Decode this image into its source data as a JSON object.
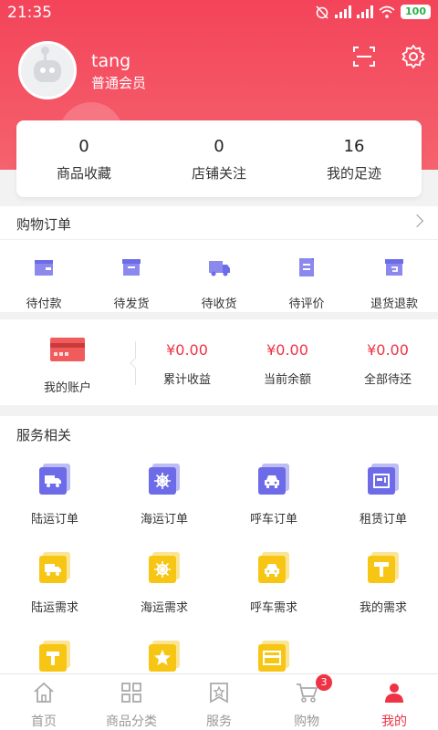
{
  "status_bar": {
    "time": "21:35",
    "battery": "100"
  },
  "profile": {
    "username": "tang",
    "level": "普通会员"
  },
  "stats": [
    {
      "value": "0",
      "label": "商品收藏"
    },
    {
      "value": "0",
      "label": "店铺关注"
    },
    {
      "value": "16",
      "label": "我的足迹"
    }
  ],
  "orders": {
    "title": "购物订单",
    "items": [
      {
        "label": "待付款",
        "icon": "wallet-card-icon"
      },
      {
        "label": "待发货",
        "icon": "box-icon"
      },
      {
        "label": "待收货",
        "icon": "truck-icon"
      },
      {
        "label": "待评价",
        "icon": "review-doc-icon"
      },
      {
        "label": "退货退款",
        "icon": "return-box-icon"
      }
    ]
  },
  "account": {
    "label": "我的账户",
    "values": [
      {
        "amount": "¥0.00",
        "label": "累计收益"
      },
      {
        "amount": "¥0.00",
        "label": "当前余额"
      },
      {
        "amount": "¥0.00",
        "label": "全部待还"
      }
    ]
  },
  "services": {
    "title": "服务相关",
    "items": [
      {
        "label": "陆运订单",
        "icon": "truck-icon",
        "color": "#6d6be8"
      },
      {
        "label": "海运订单",
        "icon": "ship-wheel-icon",
        "color": "#6d6be8"
      },
      {
        "label": "呼车订单",
        "icon": "car-icon",
        "color": "#6d6be8"
      },
      {
        "label": "租赁订单",
        "icon": "lease-icon",
        "color": "#6d6be8"
      },
      {
        "label": "陆运需求",
        "icon": "truck-icon",
        "color": "#f7c615"
      },
      {
        "label": "海运需求",
        "icon": "ship-wheel-icon",
        "color": "#f7c615"
      },
      {
        "label": "呼车需求",
        "icon": "car-icon",
        "color": "#f7c615"
      },
      {
        "label": "我的需求",
        "icon": "t-icon",
        "color": "#f7c615"
      },
      {
        "label": "",
        "icon": "hammer-icon",
        "color": "#f7c615"
      },
      {
        "label": "",
        "icon": "star-icon",
        "color": "#f7c615"
      },
      {
        "label": "",
        "icon": "card-icon",
        "color": "#f7c615"
      }
    ]
  },
  "nav": [
    {
      "label": "首页",
      "icon": "home-icon"
    },
    {
      "label": "商品分类",
      "icon": "category-icon"
    },
    {
      "label": "服务",
      "icon": "service-icon"
    },
    {
      "label": "购物",
      "icon": "cart-icon",
      "badge": "3"
    },
    {
      "label": "我的",
      "icon": "person-icon",
      "active": true
    }
  ],
  "colors": {
    "brand": "#f3445a",
    "price": "#ee3344",
    "purple": "#6d6be8",
    "yellow": "#f7c615"
  }
}
